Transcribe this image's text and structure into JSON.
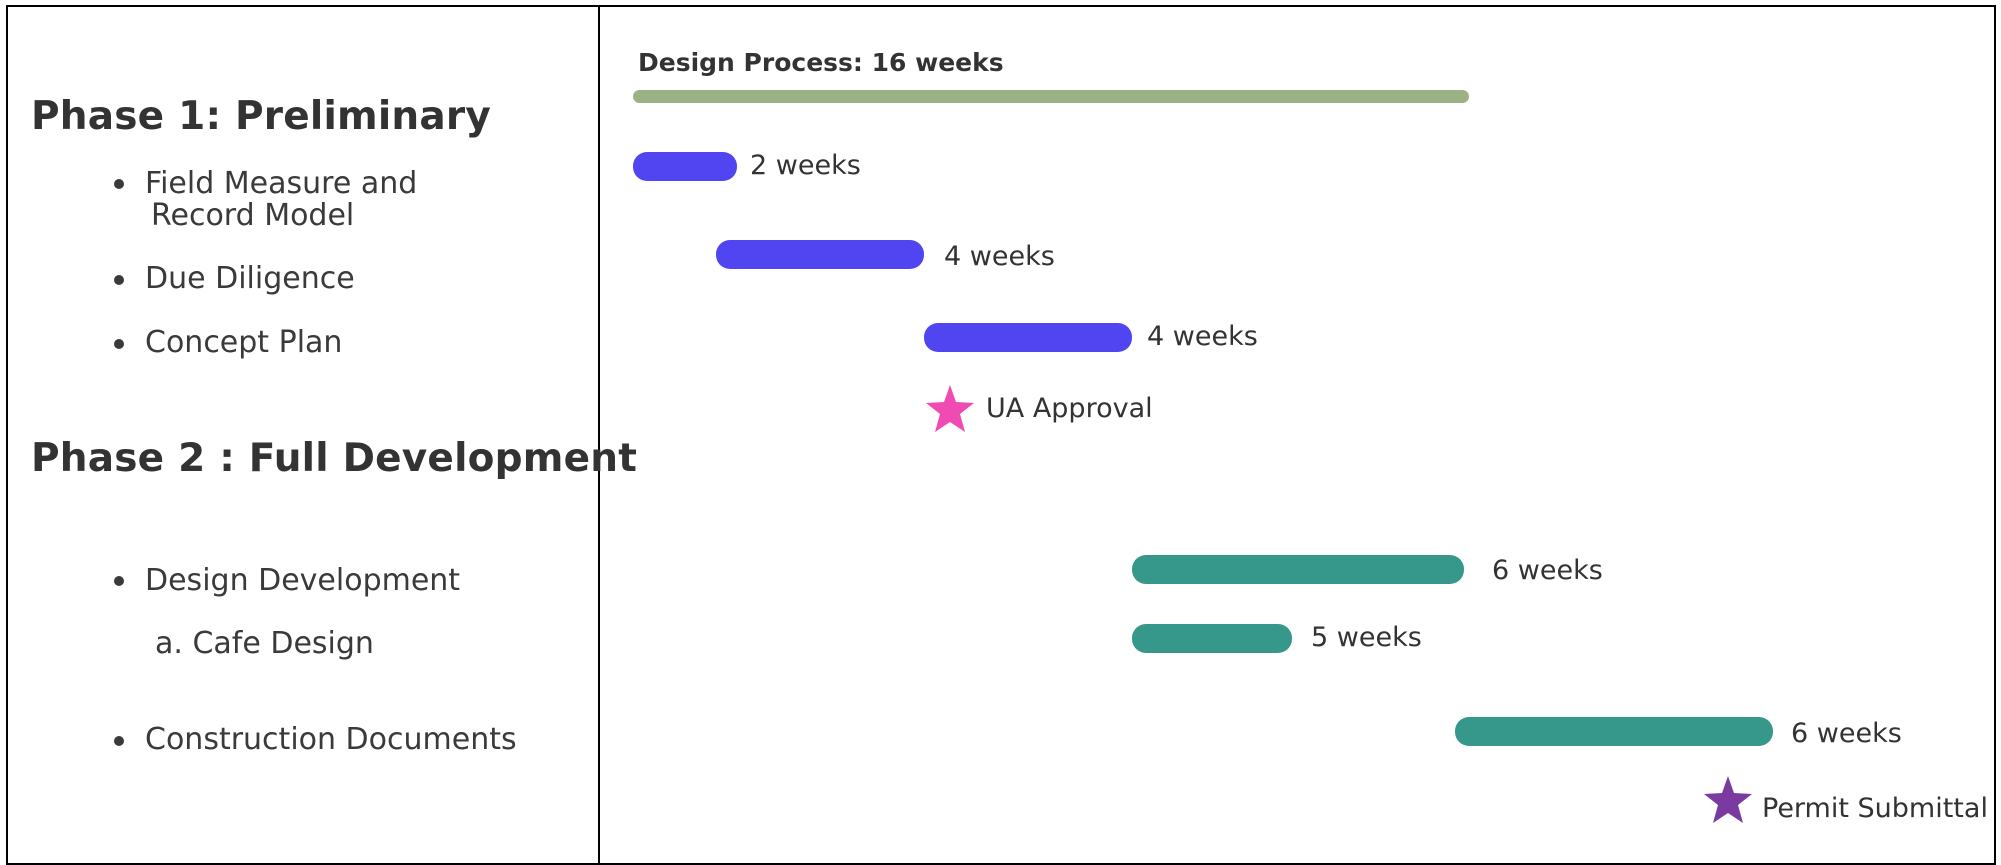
{
  "colors": {
    "overall": "#9cb184",
    "phase1": "#5145f2",
    "phase2": "#36988a",
    "milestone1": "#f04bb2",
    "milestone2": "#7b3aa0"
  },
  "left_panel": {
    "phase1": {
      "title": "Phase 1: Preliminary",
      "tasks": [
        "Field Measure and",
        "Record Model",
        "Due Diligence",
        "Concept Plan"
      ]
    },
    "phase2": {
      "title": "Phase 2 : Full Development",
      "tasks": [
        "Design Development",
        "a. Cafe Design",
        "Construction Documents"
      ]
    }
  },
  "timeline": {
    "overall_label": "Design Process: 16 weeks",
    "durations": [
      "2 weeks",
      "4 weeks",
      "4 weeks",
      "6 weeks",
      "5 weeks",
      "6 weeks"
    ],
    "milestones": [
      "UA Approval",
      "Permit Submittal"
    ],
    "star_icon": "star-icon"
  }
}
